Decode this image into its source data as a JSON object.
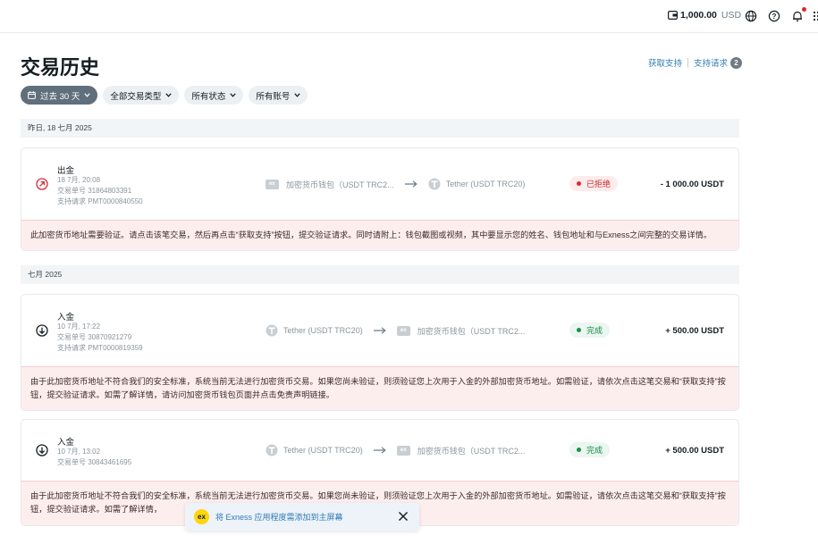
{
  "topbar": {
    "balance_value": "1,000.00",
    "balance_currency": "USD",
    "icons": [
      "wallet-icon",
      "globe-icon",
      "help-icon",
      "bell-icon",
      "apps-grid-icon"
    ]
  },
  "header": {
    "title": "交易历史",
    "get_support": "获取支持",
    "support_requests": "支持请求",
    "support_count": "2"
  },
  "filters": [
    {
      "label": "过去 30 天",
      "active": true
    },
    {
      "label": "全部交易类型"
    },
    {
      "label": "所有状态"
    },
    {
      "label": "所有账号"
    }
  ],
  "groups": [
    {
      "label": "昨日, 18 七月 2025"
    },
    {
      "label": "七月 2025"
    }
  ],
  "transactions": [
    {
      "type": "出金",
      "date": "18 7月, 20:08",
      "tx_number": "交易单号 31864803391",
      "support_request": "支持请求 PMT0000840550",
      "from": "加密货币钱包（USDT TRC2...",
      "to": "Tether (USDT TRC20)",
      "status": "已拒绝",
      "amount": "- 1 000.00 USDT",
      "warning": "此加密货币地址需要验证。请点击该笔交易，然后再点击“获取支持”按钮，提交验证请求。同时请附上：钱包截图或视频，其中要显示您的姓名、钱包地址和与Exness之间完整的交易详情。"
    },
    {
      "type": "入金",
      "date": "10 7月, 17:22",
      "tx_number": "交易单号 30870921279",
      "support_request": "支持请求 PMT0000819359",
      "from": "Tether (USDT TRC20)",
      "to": "加密货币钱包（USDT TRC2...",
      "status": "完成",
      "amount": "+ 500.00 USDT",
      "warning": "由于此加密货币地址不符合我们的安全标准，系统当前无法进行加密货币交易。如果您尚未验证，则须验证您上次用于入金的外部加密货币地址。如需验证，请依次点击这笔交易和“获取支持”按钮，提交验证请求。如需了解详情，请访问加密货币钱包页面并点击免责声明链接。"
    },
    {
      "type": "入金",
      "date": "10 7月, 13:02",
      "tx_number": "交易单号 30843461695",
      "from": "Tether (USDT TRC20)",
      "to": "加密货币钱包（USDT TRC2...",
      "status": "完成",
      "amount": "+ 500.00 USDT",
      "warning": "由于此加密货币地址不符合我们的安全标准，系统当前无法进行加密货币交易。如果您尚未验证，则须验证您上次用于入金的外部加密货币地址。如需验证，请依次点击这笔交易和“获取支持”按钮，提交验证请求。如需了解详情，"
    }
  ],
  "toast": {
    "logo": "ex",
    "text": "将 Exness 应用程度需添加到主屏幕"
  },
  "colors": {
    "accent_link": "#2e7bb6",
    "active_filter": "#5f6f7b",
    "rejected": "#d92b36",
    "completed": "#17924a",
    "warning_bg": "#fdeeee"
  }
}
